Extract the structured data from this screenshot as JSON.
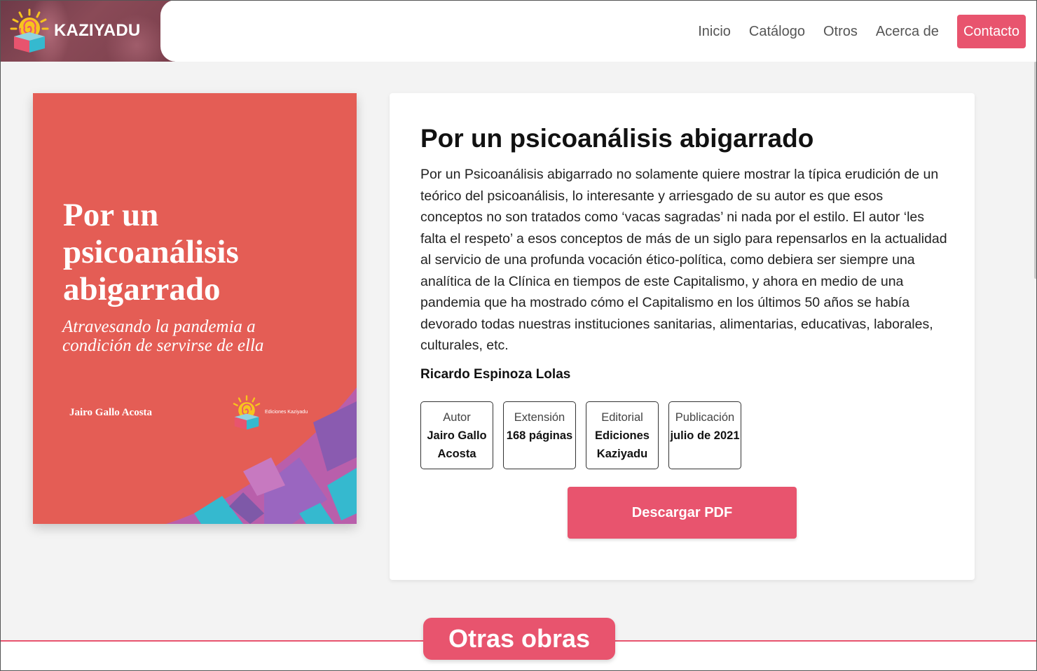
{
  "header": {
    "brand_name": "KAZIYADU",
    "nav": [
      {
        "label": "Inicio"
      },
      {
        "label": "Catálogo"
      },
      {
        "label": "Otros"
      },
      {
        "label": "Acerca de"
      },
      {
        "label": "Contacto"
      }
    ]
  },
  "cover": {
    "title_line1": "Por un",
    "title_line2": "psicoanálisis",
    "title_line3": "abigarrado",
    "subtitle_line1": "Atravesando la pandemia a",
    "subtitle_line2": "condición de servirse de ella",
    "author": "Jairo Gallo Acosta",
    "imprint": "Ediciones Kaziyadu"
  },
  "book": {
    "title": "Por un psicoanálisis abigarrado",
    "description": "Por un Psicoanálisis abigarrado no solamente quiere mostrar la típica erudición de un teórico del psicoanálisis, lo interesante y arriesgado de su autor es que esos conceptos no son tratados como ‘vacas sagradas’ ni nada por el estilo. El autor ‘les falta el respeto’ a esos conceptos de más de un siglo para repensarlos en la actualidad al servicio de una profunda vocación ético-política, como debiera ser siempre una analítica de la Clínica en tiempos de este Capitalismo, y ahora en medio de una pandemia que ha mostrado cómo el Capitalismo en los últimos 50 años se había devorado todas nuestras instituciones sanitarias, alimentarias, educativas, laborales, culturales, etc.",
    "review_author": "Ricardo Espinoza Lolas",
    "meta": [
      {
        "key": "Autor",
        "value": "Jairo Gallo Acosta"
      },
      {
        "key": "Extensión",
        "value": "168 páginas"
      },
      {
        "key": "Editorial",
        "value": "Ediciones Kaziyadu"
      },
      {
        "key": "Publicación",
        "value": "julio de 2021"
      }
    ],
    "download_label": "Descargar PDF"
  },
  "section": {
    "title": "Otras obras"
  },
  "colors": {
    "accent": "#e8546e",
    "cover_red": "#e45d55",
    "cover_purple": "#b95fab",
    "cover_cyan": "#35b9cf"
  }
}
